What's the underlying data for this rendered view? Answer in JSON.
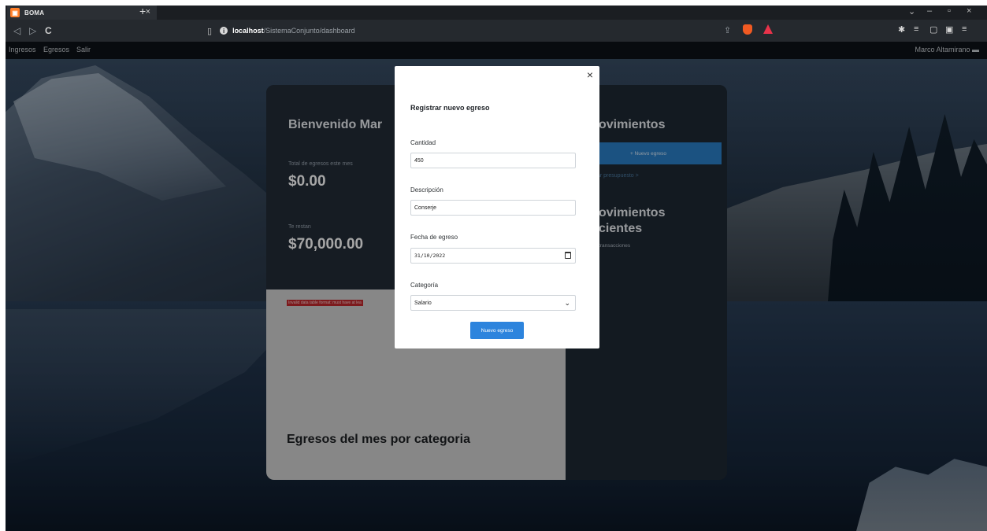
{
  "browser": {
    "tab_title": "BOMA",
    "tab_favicon_glyph": "▣",
    "tab_close": "×",
    "new_tab": "+",
    "url_host": "localhost",
    "url_path": "/SistemaConjunto/dashboard",
    "window_controls": [
      "⌄",
      "–",
      "▫",
      "×"
    ]
  },
  "nav": {
    "items": [
      "Ingresos",
      "Egresos",
      "Salir"
    ],
    "user": "Marco Altamirano"
  },
  "dashboard": {
    "welcome": "Bienvenido Mar",
    "total_label": "Total de egresos este mes",
    "total_value": "$0.00",
    "remaining_label": "Te restan",
    "remaining_value": "$70,000.00",
    "error_text": "Invalid data table format: must have at lea",
    "chart_title": "Egresos del mes por categoria",
    "right_title": "ovimientos",
    "new_button": "+ Nuevo egreso",
    "budget_link": "ar presupuesto >",
    "recent_title_1": "ovimientos",
    "recent_title_2": "cientes",
    "tx_count": "transacciones"
  },
  "modal": {
    "close": "×",
    "title": "Registrar nuevo egreso",
    "fields": {
      "cantidad_label": "Cantidad",
      "cantidad_value": "450",
      "descripcion_label": "Descripción",
      "descripcion_value": "Conserje",
      "fecha_label": "Fecha de egreso",
      "fecha_value": "31/10/2022",
      "categoria_label": "Categoría",
      "categoria_value": "Salario"
    },
    "submit": "Nuevo egreso"
  },
  "colors": {
    "accent": "#2d84dd",
    "error": "#c0282d",
    "nav_bg": "#0d1117"
  }
}
